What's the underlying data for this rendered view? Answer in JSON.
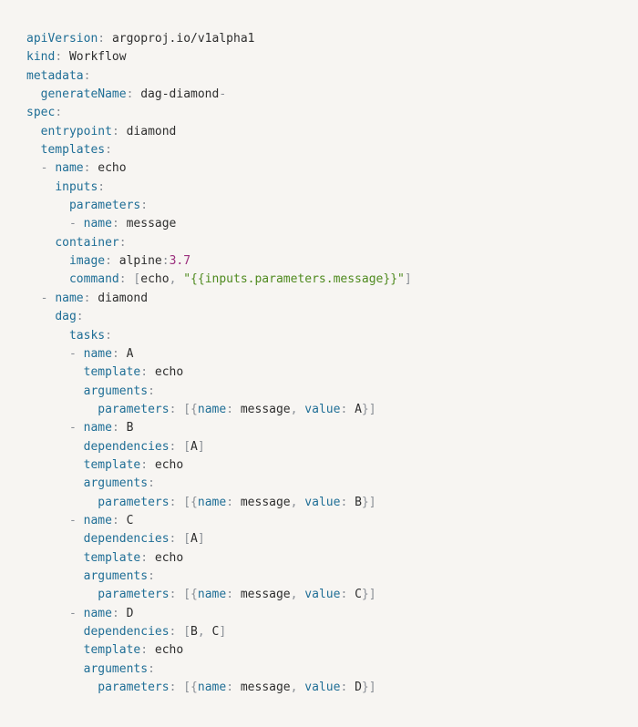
{
  "colors": {
    "background": "#f7f5f2",
    "key": "#1f6e96",
    "punctuation": "#8a8f96",
    "text": "#2e2e2e",
    "number": "#9b2f7d",
    "string": "#4f8a1f"
  },
  "code": {
    "l1_key": "apiVersion",
    "l1_val": "argoproj.io/v1alpha1",
    "l2_key": "kind",
    "l2_val": "Workflow",
    "l3_key": "metadata",
    "l4_key": "generateName",
    "l4_val": "dag-diamond",
    "l5_key": "spec",
    "l6_key": "entrypoint",
    "l6_val": "diamond",
    "l7_key": "templates",
    "l8_key": "name",
    "l8_val": "echo",
    "l9_key": "inputs",
    "l10_key": "parameters",
    "l11_key": "name",
    "l11_val": "message",
    "l12_key": "container",
    "l13_key": "image",
    "l13_val": "alpine",
    "l13_num": "3.7",
    "l14_key": "command",
    "l14_val": "echo",
    "l14_str": "\"{{inputs.parameters.message}}\"",
    "l15_key": "name",
    "l15_val": "diamond",
    "l16_key": "dag",
    "l17_key": "tasks",
    "l18_key": "name",
    "l18_val": "A",
    "l19_key": "template",
    "l19_val": "echo",
    "l20_key": "arguments",
    "l21_key": "parameters",
    "l21_k1": "name",
    "l21_v1": "message",
    "l21_k2": "value",
    "l21_v2": "A",
    "l22_key": "name",
    "l22_val": "B",
    "l23_key": "dependencies",
    "l23_val": "A",
    "l24_key": "template",
    "l24_val": "echo",
    "l25_key": "arguments",
    "l26_key": "parameters",
    "l26_k1": "name",
    "l26_v1": "message",
    "l26_k2": "value",
    "l26_v2": "B",
    "l27_key": "name",
    "l27_val": "C",
    "l28_key": "dependencies",
    "l28_val": "A",
    "l29_key": "template",
    "l29_val": "echo",
    "l30_key": "arguments",
    "l31_key": "parameters",
    "l31_k1": "name",
    "l31_v1": "message",
    "l31_k2": "value",
    "l31_v2": "C",
    "l32_key": "name",
    "l32_val": "D",
    "l33_key": "dependencies",
    "l33_v1": "B",
    "l33_v2": "C",
    "l34_key": "template",
    "l34_val": "echo",
    "l35_key": "arguments",
    "l36_key": "parameters",
    "l36_k1": "name",
    "l36_v1": "message",
    "l36_k2": "value",
    "l36_v2": "D"
  }
}
